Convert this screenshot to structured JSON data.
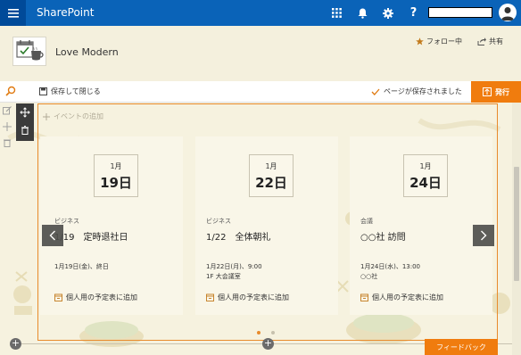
{
  "suite_bar": {
    "brand": "SharePoint",
    "colors": {
      "bar": "#0a63b8",
      "waffle": "#004a99"
    },
    "icons": [
      "waffle-icon",
      "app-launcher-icon",
      "bell-icon",
      "gear-icon",
      "help-icon",
      "avatar-icon"
    ],
    "help_label": "?"
  },
  "site_header": {
    "title": "Love Modern",
    "follow_label": "フォロー中",
    "share_label": "共有"
  },
  "command_bar": {
    "save_close_label": "保存して閉じる",
    "status_label": "ページが保存されました",
    "publish_label": "発行",
    "accent": "#f07c0e"
  },
  "canvas": {
    "add_event_label": "イベントの追加",
    "events": [
      {
        "month": "1月",
        "day": "19日",
        "category": "ビジネス",
        "title": "1/19　定時退社日",
        "when": "1月19日(金)、終日",
        "where": "",
        "add_to_calendar": "個人用の予定表に追加"
      },
      {
        "month": "1月",
        "day": "22日",
        "category": "ビジネス",
        "title": "1/22　全体朝礼",
        "when": "1月22日(月)、9:00",
        "where": "1F 大会議室",
        "add_to_calendar": "個人用の予定表に追加"
      },
      {
        "month": "1月",
        "day": "24日",
        "category": "会議",
        "title": "○○社 訪問",
        "when": "1月24日(水)、13:00",
        "where": "○○社",
        "add_to_calendar": "個人用の予定表に追加"
      }
    ],
    "carousel": {
      "pages": 2,
      "active_page": 1
    }
  },
  "feedback_label": "フィードバック"
}
